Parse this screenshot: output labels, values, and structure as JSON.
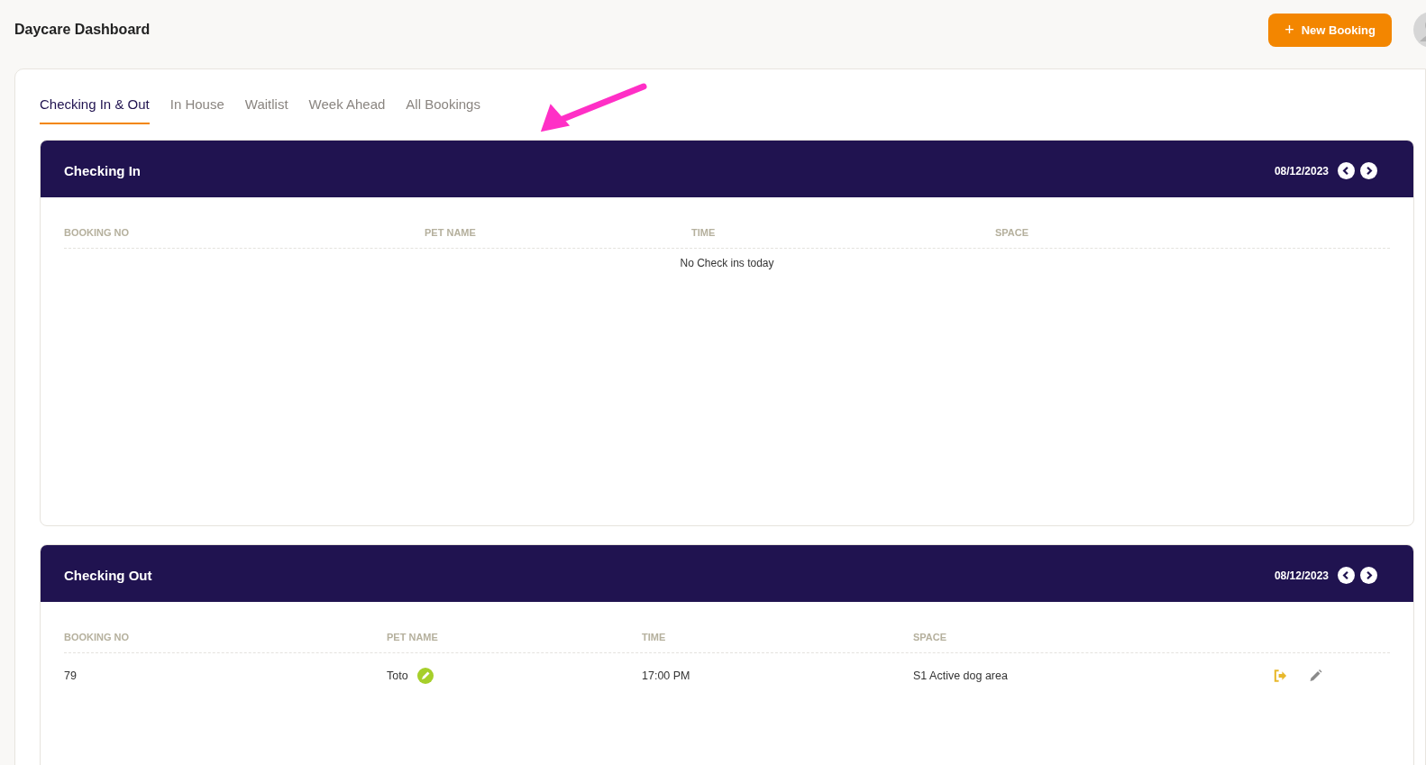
{
  "header": {
    "title": "Daycare Dashboard",
    "new_booking_button": {
      "icon": "+",
      "label": "New Booking"
    }
  },
  "tabs": [
    {
      "label": "Checking In & Out",
      "selected": true
    },
    {
      "label": "In House",
      "selected": false
    },
    {
      "label": "Waitlist",
      "selected": false
    },
    {
      "label": "Week Ahead",
      "selected": false
    },
    {
      "label": "All Bookings",
      "selected": false
    }
  ],
  "sections": [
    {
      "title": "Checking In",
      "date": "08/12/2023",
      "columns": [
        "BOOKING NO",
        "PET NAME",
        "TIME",
        "SPACE"
      ],
      "empty_message": "No Check ins today"
    },
    {
      "title": "Checking Out",
      "date": "08/12/2023",
      "columns": [
        "BOOKING NO",
        "PET NAME",
        "TIME",
        "SPACE"
      ],
      "rows": [
        {
          "booking_no": "79",
          "pet_name": "Toto",
          "time": "17:00 PM",
          "space": "S1 Active dog area"
        }
      ]
    }
  ]
}
